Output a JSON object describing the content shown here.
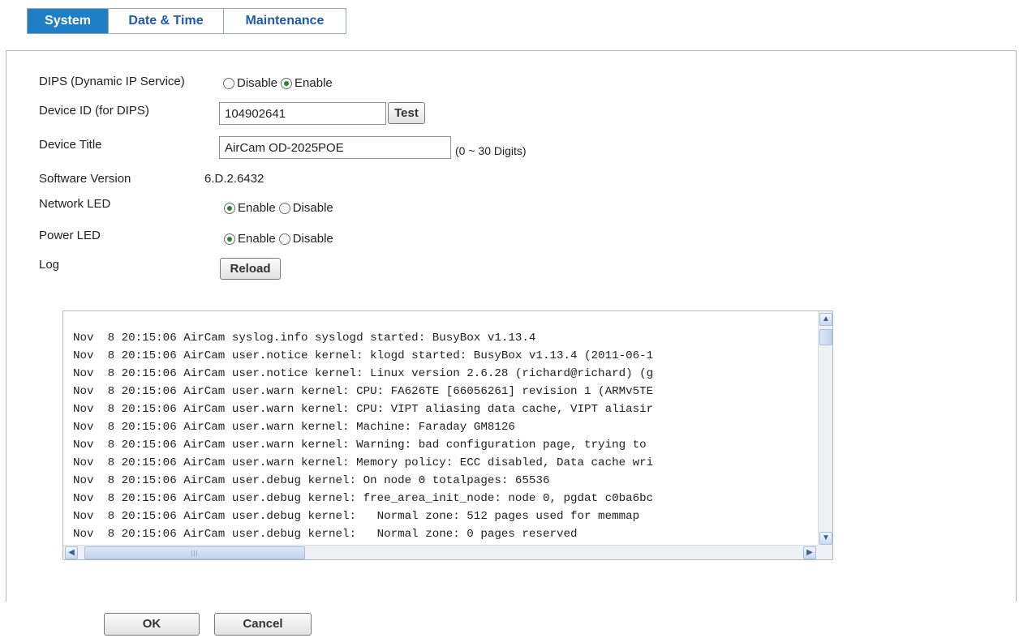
{
  "tabs": [
    {
      "label": "System",
      "active": true
    },
    {
      "label": "Date & Time",
      "active": false
    },
    {
      "label": "Maintenance",
      "active": false
    }
  ],
  "form": {
    "dips": {
      "label": "DIPS (Dynamic IP Service)",
      "options": [
        "Disable",
        "Enable"
      ],
      "selected": "Enable"
    },
    "device_id": {
      "label": "Device ID (for DIPS)",
      "value": "104902641",
      "test_label": "Test"
    },
    "device_title": {
      "label": "Device Title",
      "value": "AirCam OD-2025POE",
      "hint": "(0 ~ 30 Digits)"
    },
    "software_version": {
      "label": "Software Version",
      "value": "6.D.2.6432"
    },
    "network_led": {
      "label": "Network LED",
      "options": [
        "Enable",
        "Disable"
      ],
      "selected": "Enable"
    },
    "power_led": {
      "label": "Power LED",
      "options": [
        "Enable",
        "Disable"
      ],
      "selected": "Enable"
    },
    "log": {
      "label": "Log",
      "reload_label": "Reload"
    }
  },
  "log_lines": [
    "Nov  8 20:15:06 AirCam syslog.info syslogd started: BusyBox v1.13.4",
    "Nov  8 20:15:06 AirCam user.notice kernel: klogd started: BusyBox v1.13.4 (2011-06-1",
    "Nov  8 20:15:06 AirCam user.notice kernel: Linux version 2.6.28 (richard@richard) (g",
    "Nov  8 20:15:06 AirCam user.warn kernel: CPU: FA626TE [66056261] revision 1 (ARMv5TE",
    "Nov  8 20:15:06 AirCam user.warn kernel: CPU: VIPT aliasing data cache, VIPT aliasir",
    "Nov  8 20:15:06 AirCam user.warn kernel: Machine: Faraday GM8126",
    "Nov  8 20:15:06 AirCam user.warn kernel: Warning: bad configuration page, trying to",
    "Nov  8 20:15:06 AirCam user.warn kernel: Memory policy: ECC disabled, Data cache wri",
    "Nov  8 20:15:06 AirCam user.debug kernel: On node 0 totalpages: 65536",
    "Nov  8 20:15:06 AirCam user.debug kernel: free_area_init_node: node 0, pgdat c0ba6bc",
    "Nov  8 20:15:06 AirCam user.debug kernel:   Normal zone: 512 pages used for memmap",
    "Nov  8 20:15:06 AirCam user.debug kernel:   Normal zone: 0 pages reserved"
  ],
  "footer": {
    "ok_label": "OK",
    "cancel_label": "Cancel"
  },
  "icons": {
    "scroll_up": "chevron-up-icon",
    "scroll_down": "chevron-down-icon",
    "scroll_left": "chevron-left-icon",
    "scroll_right": "chevron-right-icon"
  },
  "colors": {
    "active_tab": "#1e7fc6",
    "tab_text": "#1f5aa8",
    "radio_selected": "#2f7d3a"
  }
}
